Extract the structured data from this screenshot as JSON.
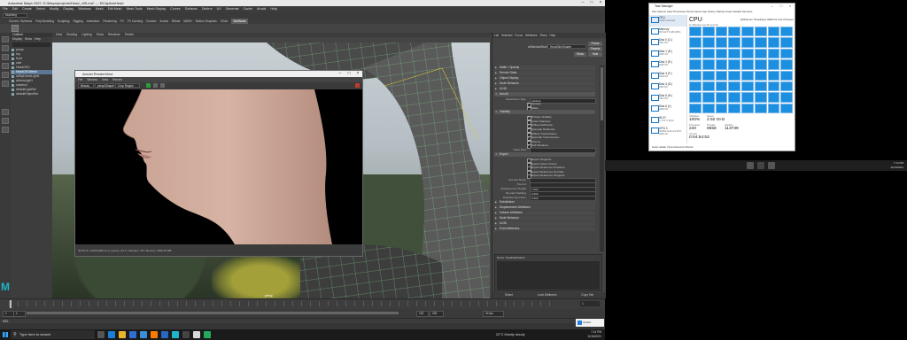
{
  "maya": {
    "title": "Autodesk Maya 2022: D:\\Maya\\projects\\Head_v05.ma* --- ElCapitanHead",
    "menus": [
      "File",
      "Edit",
      "Create",
      "Select",
      "Modify",
      "Display",
      "Windows",
      "Mesh",
      "Edit Mesh",
      "Mesh Tools",
      "Mesh Display",
      "Curves",
      "Surfaces",
      "Deform",
      "UV",
      "Generate",
      "Cache",
      "Arnold",
      "Help"
    ],
    "workspace": "Modeling",
    "shelf_tabs": [
      "Curves / Surfaces",
      "Poly Modeling",
      "Sculpting",
      "Rigging",
      "Animation",
      "Rendering",
      "FX",
      "FX Caching",
      "Custom",
      "Arnold",
      "Bifrost",
      "MASH",
      "Motion Graphics",
      "XGen",
      "StarBlade"
    ],
    "active_shelf": "StarBlade"
  },
  "outliner": {
    "title": "Outliner",
    "menu": [
      "Display",
      "Show",
      "Help"
    ],
    "items": [
      {
        "label": "persp",
        "selected": false
      },
      {
        "label": "top",
        "selected": false
      },
      {
        "label": "front",
        "selected": false
      },
      {
        "label": "side",
        "selected": false
      },
      {
        "label": "HeadGEO",
        "selected": false
      },
      {
        "label": "HeadGEOMesh",
        "selected": true
      },
      {
        "label": "aiSkyDomeLight1",
        "selected": false
      },
      {
        "label": "aiAreaLight1",
        "selected": false
      },
      {
        "label": "camera1",
        "selected": false
      },
      {
        "label": "defaultLightSet",
        "selected": false
      },
      {
        "label": "defaultObjectSet",
        "selected": false
      }
    ]
  },
  "viewport": {
    "menus": [
      "View",
      "Shading",
      "Lighting",
      "Show",
      "Renderer",
      "Panels"
    ],
    "label": "persp"
  },
  "renderview": {
    "title": "Arnold RenderView",
    "menus": [
      "File",
      "Window",
      "View",
      "Render"
    ],
    "dropdowns": [
      "Beauty",
      "persp/Shape",
      "Crop Region"
    ],
    "status": "00:00:11 | 1920x1080 (1:1) | persp | AA 3 | Samples: 3/3 | Memory: 2640.45 MB"
  },
  "attribute_editor": {
    "tabs": [
      "List",
      "Selected",
      "Focus",
      "Attributes",
      "Show",
      "Help"
    ],
    "node_label": "aiStandardSurface:",
    "node_name": "HeadSkinShader",
    "focus_label": "Focus",
    "presets_label": "Presets",
    "show_label": "Show",
    "hide_label": "Hide",
    "sections": [
      {
        "label": "Matte / Opacity",
        "open": false
      },
      {
        "label": "Render Stats",
        "open": false
      },
      {
        "label": "Object Display",
        "open": false
      },
      {
        "label": "Node Behavior",
        "open": false
      },
      {
        "label": "UUID",
        "open": false
      },
      {
        "label": "Arnold",
        "open": true
      }
    ],
    "arnold_rows": [
      {
        "type": "field",
        "label": "Subdivision Type",
        "value": "catclark"
      },
      {
        "type": "check",
        "label": "Opaque",
        "on": true
      },
      {
        "type": "check",
        "label": "Matte",
        "on": false
      }
    ],
    "visibility_title": "Visibility",
    "visibility": [
      {
        "label": "Primary Visibility",
        "on": true
      },
      {
        "label": "Casts Shadows",
        "on": true
      },
      {
        "label": "Diffuse Reflection",
        "on": true
      },
      {
        "label": "Specular Reflection",
        "on": true
      },
      {
        "label": "Diffuse Transmission",
        "on": true
      },
      {
        "label": "Specular Transmission",
        "on": true
      },
      {
        "label": "Volume",
        "on": true
      },
      {
        "label": "Self Shadows",
        "on": true
      }
    ],
    "trace_sets_label": "Trace Sets",
    "export_title": "Export",
    "export": [
      {
        "label": "Export Tangents",
        "on": false
      },
      {
        "label": "Export Vertex Colors",
        "on": false
      },
      {
        "label": "Export Reference Positions",
        "on": false
      },
      {
        "label": "Export Reference Normals",
        "on": false
      },
      {
        "label": "Export Reference Tangents",
        "on": false
      }
    ],
    "fields": [
      {
        "label": "Sss Set Name",
        "value": ""
      },
      {
        "label": "Toon Id",
        "value": ""
      },
      {
        "label": "Displacement Height",
        "value": "1.000"
      },
      {
        "label": "Bounds Padding",
        "value": "0.000"
      },
      {
        "label": "Displacement Zero",
        "value": "0.000"
      }
    ],
    "more_sections": [
      "Subdivision",
      "Displacement Attributes",
      "Volume Attributes"
    ],
    "extra_sections": [
      "Node Behavior",
      "UUID",
      "Extra Attributes"
    ],
    "notes_label": "Notes: HeadGEOMesh",
    "buttons": [
      "Select",
      "Load Attributes",
      "Copy Tab"
    ]
  },
  "timeline": {
    "current_frame": "1",
    "start": "1",
    "end": "120",
    "range_end": "200",
    "fps": "24 fps",
    "command_label": "MEL"
  },
  "task_manager": {
    "title": "Task Manager",
    "menu": "File  Options  View     Processes  Performance  App history  Startup  Users  Details  Services",
    "side": [
      {
        "label": "CPU",
        "sub": "100%  2.92 GHz",
        "selected": true
      },
      {
        "label": "Memory",
        "sub": "35.6/127.9 GB (28%)",
        "selected": false
      },
      {
        "label": "Disk 0 (C:)",
        "sub": "SSD  0%",
        "selected": false
      },
      {
        "label": "Disk 1 (D:)",
        "sub": "HDD  1%",
        "selected": false
      },
      {
        "label": "Disk 2 (E:)",
        "sub": "HDD  0%",
        "selected": false
      },
      {
        "label": "Disk 3 (F:)",
        "sub": "HDD  0%",
        "selected": false
      },
      {
        "label": "Disk 4 (G:)",
        "sub": "SSD  0%",
        "selected": false
      },
      {
        "label": "Disk 5 (H:)",
        "sub": "SSD  0%",
        "selected": false
      },
      {
        "label": "Disk 6 (I:)",
        "sub": "HDD  0%",
        "selected": false
      },
      {
        "label": "Wi-Fi",
        "sub": "S: 0  R: 0 Kbps",
        "selected": false
      },
      {
        "label": "GPU 0",
        "sub": "NVIDIA GeForce RTX 3090  2%",
        "selected": false
      }
    ],
    "heading": "CPU",
    "processor": "AMD Ryzen Threadripper 3990X 64-Core Processor",
    "util_label": "% Utilization over 60 seconds",
    "stats": {
      "utilization_label": "Utilization",
      "utilization": "100%",
      "speed_label": "Speed",
      "speed": "2.92 GHz",
      "processes_label": "Processes",
      "processes": "240",
      "threads_label": "Threads",
      "threads": "8558",
      "handles_label": "Handles",
      "handles": "113739",
      "uptime_label": "Up time",
      "uptime": "0:04:54:53"
    },
    "footer": "Fewer details  |  Open Resource Monitor"
  },
  "taskbar": {
    "search_placeholder": "Type here to search",
    "weather": "22°C  Mostly cloudy",
    "time": "7:14 PM",
    "date": "11/16/2021",
    "right_time": "7:14 PM",
    "right_date": "11/16/2021",
    "popup": "Arnold"
  }
}
